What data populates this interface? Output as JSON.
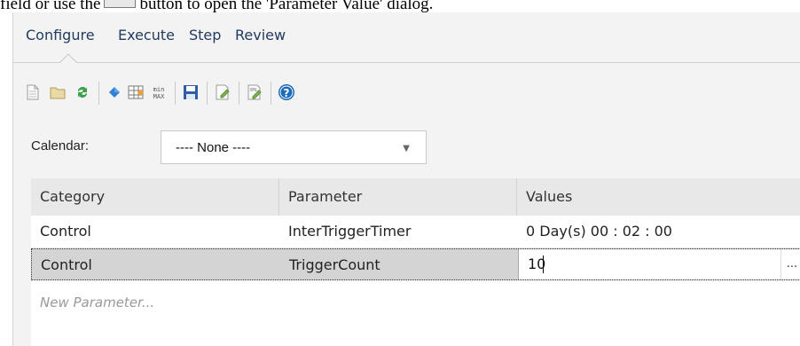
{
  "doc_text": {
    "before": "field or use the",
    "after": "button to open the 'Parameter Value' dialog."
  },
  "tabs": [
    {
      "label": "Configure",
      "active": true
    },
    {
      "label": "Execute",
      "active": false
    },
    {
      "label": "Step",
      "active": false
    },
    {
      "label": "Review",
      "active": false
    }
  ],
  "toolbar": {
    "icons": [
      "new-document-icon",
      "open-folder-icon",
      "refresh-icon",
      "gem-icon",
      "table-grid-icon",
      "min-max-icon",
      "save-icon",
      "edit-document-icon",
      "xml-document-icon",
      "help-icon"
    ]
  },
  "calendar": {
    "label": "Calendar:",
    "selected": "---- None ----"
  },
  "grid": {
    "headers": [
      "Category",
      "Parameter",
      "Values"
    ],
    "rows": [
      {
        "category": "Control",
        "parameter": "InterTriggerTimer",
        "value": "0 Day(s) 00 : 02 : 00"
      },
      {
        "category": "Control",
        "parameter": "TriggerCount",
        "value": "10"
      }
    ],
    "new_parameter": "New Parameter...",
    "ellipsis": "..."
  },
  "colors": {
    "tab_text": "#233b60",
    "panel_bg": "#f3f3f3",
    "selected_row": "#d4d4d4",
    "help_blue": "#1e6bb8",
    "gem_blue": "#2e7fd6",
    "refresh_green": "#3aa34a"
  }
}
